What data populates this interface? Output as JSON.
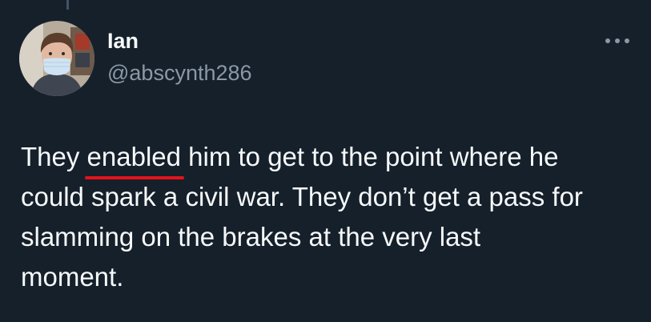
{
  "author": {
    "name": "Ian",
    "handle": "@abscynth286",
    "avatar_icon": "user-avatar-photo"
  },
  "menu": {
    "icon": "more-horizontal-icon"
  },
  "tweet": {
    "line1": {
      "before": "They ",
      "highlight": "enabled",
      "after": " him to get to the point where he"
    },
    "line2": "could spark a civil war. They don’t get a pass for",
    "line3": "slamming on the brakes at the very last",
    "line4": "moment."
  },
  "colors": {
    "background": "#15202b",
    "primary_text": "#f7f9f9",
    "secondary_text": "#8b98a5",
    "annotation_underline": "#e2141b"
  }
}
